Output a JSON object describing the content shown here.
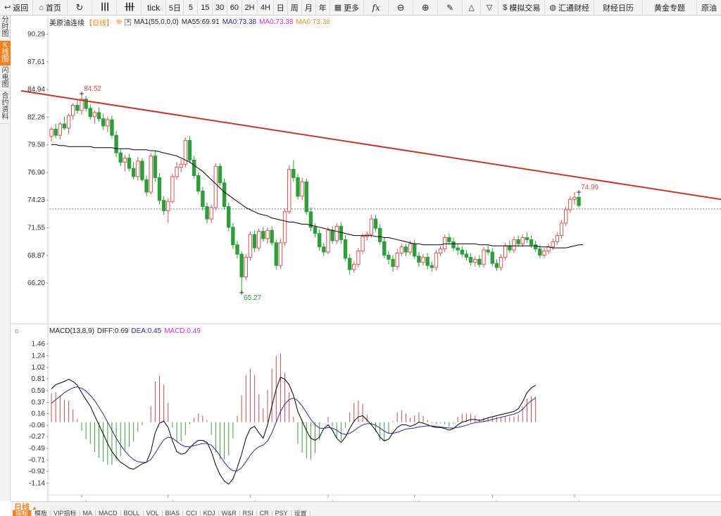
{
  "toolbar": {
    "back": "返回",
    "home": "首页",
    "tick": "tick",
    "periods": [
      "5日",
      "5",
      "15",
      "30",
      "60",
      "2H",
      "4H",
      "日",
      "周",
      "月",
      "年"
    ],
    "more": "更多",
    "fx": "fx",
    "sim_trade": "模拟交易",
    "hui_tong": "汇通财经",
    "calendar": "财经日历",
    "gold": "黄金专题",
    "oil": "原油"
  },
  "left_tabs": [
    {
      "label": "分时图",
      "active": false
    },
    {
      "label": "K线图",
      "active": true
    },
    {
      "label": "闪电图",
      "active": false
    },
    {
      "label": "合约资料",
      "active": false
    }
  ],
  "main_legend": {
    "symbol": "美原油连续",
    "period": "【日线】",
    "ma1": "MA1(55,0,0,0)",
    "ma55": "MA55:69.91",
    "ma0a": "MA0:73.38",
    "ma0b": "MA0:73.38",
    "ma0c": "MA0:73.38"
  },
  "macd_legend": {
    "name": "MACD(13,8,9)",
    "diff": "DIFF:0.69",
    "dea": "DEA:0.45",
    "macd": "MACD:0.49"
  },
  "colors": {
    "up": "#d9534f",
    "down": "#2e9d3a",
    "trendline": "#c0392b",
    "ma": "#000000",
    "dea": "#2a2a9a",
    "macd_label": "#cc33cc",
    "accent": "#f58220",
    "axis_text": "#333333"
  },
  "bottom": {
    "period_label": "日线",
    "indicator_tabs": [
      {
        "label": "指标",
        "active": true
      },
      {
        "label": "模板",
        "active": false
      },
      {
        "label": "VIP指标",
        "active": false
      },
      {
        "label": "MA",
        "active": false
      },
      {
        "label": "MACD",
        "active": false
      },
      {
        "label": "BOLL",
        "active": false
      },
      {
        "label": "VOL",
        "active": false
      },
      {
        "label": "BIAS",
        "active": false
      },
      {
        "label": "CCI",
        "active": false
      },
      {
        "label": "KDJ",
        "active": false
      },
      {
        "label": "W&R",
        "active": false
      },
      {
        "label": "RSI",
        "active": false
      },
      {
        "label": "CR",
        "active": false
      },
      {
        "label": "PSY",
        "active": false
      },
      {
        "label": "设置",
        "active": false
      }
    ]
  },
  "chart_data": [
    {
      "type": "candlestick",
      "title": "美原油连续",
      "y_ticks": [
        "90.29",
        "87.61",
        "84.94",
        "82.26",
        "79.58",
        "76.90",
        "74.23",
        "71.55",
        "68.87",
        "66.20"
      ],
      "ylim": [
        64.3,
        91.0
      ],
      "x_ticks": [
        "2024/07",
        "2024/08",
        "2024/09",
        "2024/10",
        "2024/11",
        "2024/12",
        "2025/01"
      ],
      "annotations": [
        {
          "text": "84.52",
          "value": 84.52,
          "index": 7
        },
        {
          "text": "65.27",
          "value": 65.27,
          "index": 44
        },
        {
          "text": "74.99",
          "value": 74.99,
          "index": 122
        }
      ],
      "current_price": 73.38,
      "trendline": {
        "from": {
          "index": -7,
          "value": 84.8
        },
        "to": {
          "index": 161,
          "value": 73.9
        }
      },
      "candles": [
        [
          80.4,
          81.3,
          79.9,
          81.1
        ],
        [
          81.1,
          81.6,
          80.2,
          80.5
        ],
        [
          80.5,
          81.8,
          80.1,
          81.6
        ],
        [
          81.6,
          82.3,
          81.0,
          81.2
        ],
        [
          81.2,
          82.6,
          80.6,
          82.4
        ],
        [
          82.4,
          83.6,
          82.0,
          83.4
        ],
        [
          83.4,
          83.9,
          82.6,
          82.9
        ],
        [
          82.9,
          84.52,
          82.5,
          84.0
        ],
        [
          84.0,
          84.3,
          82.8,
          83.1
        ],
        [
          83.1,
          83.5,
          82.0,
          82.3
        ],
        [
          82.3,
          82.9,
          81.6,
          82.7
        ],
        [
          82.7,
          83.2,
          81.8,
          82.1
        ],
        [
          82.1,
          82.6,
          81.0,
          81.4
        ],
        [
          81.4,
          82.3,
          80.8,
          82.0
        ],
        [
          82.0,
          82.4,
          80.2,
          80.5
        ],
        [
          80.5,
          80.9,
          78.4,
          78.8
        ],
        [
          78.8,
          79.2,
          77.5,
          77.9
        ],
        [
          77.9,
          78.6,
          77.0,
          78.3
        ],
        [
          78.3,
          78.7,
          77.0,
          77.3
        ],
        [
          77.3,
          77.9,
          76.2,
          76.5
        ],
        [
          76.5,
          78.4,
          76.1,
          78.0
        ],
        [
          78.0,
          78.3,
          76.0,
          76.2
        ],
        [
          76.2,
          76.6,
          74.6,
          75.0
        ],
        [
          75.0,
          78.8,
          74.8,
          78.5
        ],
        [
          78.5,
          79.0,
          76.0,
          76.4
        ],
        [
          76.4,
          76.8,
          73.8,
          74.2
        ],
        [
          74.2,
          74.6,
          72.8,
          73.2
        ],
        [
          73.2,
          74.4,
          72.0,
          74.1
        ],
        [
          74.1,
          76.8,
          73.9,
          76.5
        ],
        [
          76.5,
          77.9,
          76.2,
          77.4
        ],
        [
          77.4,
          78.2,
          76.9,
          77.7
        ],
        [
          77.7,
          80.3,
          77.4,
          80.0
        ],
        [
          80.0,
          80.4,
          77.8,
          78.1
        ],
        [
          78.1,
          78.5,
          76.3,
          76.6
        ],
        [
          76.6,
          76.9,
          74.8,
          75.1
        ],
        [
          75.1,
          75.5,
          73.2,
          73.6
        ],
        [
          73.6,
          74.0,
          72.0,
          72.4
        ],
        [
          72.4,
          73.8,
          72.0,
          73.5
        ],
        [
          73.5,
          77.8,
          73.2,
          77.5
        ],
        [
          77.5,
          77.8,
          75.6,
          75.9
        ],
        [
          75.9,
          76.3,
          73.3,
          73.6
        ],
        [
          73.6,
          74.0,
          71.2,
          71.6
        ],
        [
          71.6,
          72.0,
          69.5,
          69.9
        ],
        [
          69.9,
          70.3,
          68.6,
          69.0
        ],
        [
          69.0,
          69.3,
          65.27,
          66.8
        ],
        [
          66.8,
          69.0,
          66.5,
          68.7
        ],
        [
          68.7,
          71.2,
          68.4,
          70.9
        ],
        [
          70.9,
          71.3,
          69.2,
          69.6
        ],
        [
          69.6,
          71.5,
          69.3,
          71.2
        ],
        [
          71.2,
          71.6,
          70.2,
          70.5
        ],
        [
          70.5,
          71.6,
          70.0,
          71.3
        ],
        [
          71.3,
          71.7,
          69.8,
          70.1
        ],
        [
          70.1,
          70.4,
          67.5,
          67.9
        ],
        [
          67.9,
          70.5,
          67.6,
          70.1
        ],
        [
          70.1,
          73.4,
          69.8,
          73.1
        ],
        [
          73.1,
          77.6,
          72.9,
          77.2
        ],
        [
          77.2,
          78.1,
          76.0,
          76.4
        ],
        [
          76.4,
          76.8,
          74.3,
          74.6
        ],
        [
          74.6,
          76.4,
          74.2,
          76.0
        ],
        [
          76.0,
          76.3,
          72.8,
          73.1
        ],
        [
          73.1,
          73.5,
          71.2,
          71.6
        ],
        [
          71.6,
          72.0,
          70.6,
          71.0
        ],
        [
          71.0,
          71.4,
          69.3,
          69.7
        ],
        [
          69.7,
          70.1,
          68.8,
          69.2
        ],
        [
          69.2,
          71.6,
          69.0,
          71.3
        ],
        [
          71.3,
          71.7,
          70.0,
          70.3
        ],
        [
          70.3,
          72.0,
          70.0,
          71.7
        ],
        [
          71.7,
          72.1,
          70.0,
          70.4
        ],
        [
          70.4,
          70.8,
          68.3,
          68.6
        ],
        [
          68.6,
          69.0,
          67.0,
          67.5
        ],
        [
          67.5,
          68.3,
          67.2,
          68.0
        ],
        [
          68.0,
          69.6,
          67.7,
          69.3
        ],
        [
          69.3,
          71.0,
          69.0,
          70.7
        ],
        [
          70.7,
          71.2,
          70.3,
          70.9
        ],
        [
          70.9,
          72.8,
          70.6,
          72.4
        ],
        [
          72.4,
          72.8,
          71.2,
          71.5
        ],
        [
          71.5,
          71.9,
          69.9,
          70.2
        ],
        [
          70.2,
          70.6,
          68.6,
          68.9
        ],
        [
          68.9,
          69.3,
          68.0,
          68.5
        ],
        [
          68.5,
          68.9,
          67.3,
          67.8
        ],
        [
          67.8,
          69.5,
          67.5,
          69.1
        ],
        [
          69.1,
          70.0,
          68.8,
          69.7
        ],
        [
          69.7,
          70.0,
          68.8,
          69.2
        ],
        [
          69.2,
          70.3,
          68.9,
          70.0
        ],
        [
          70.0,
          70.4,
          68.5,
          68.8
        ],
        [
          68.8,
          69.2,
          67.8,
          68.2
        ],
        [
          68.2,
          69.0,
          67.9,
          68.7
        ],
        [
          68.7,
          69.1,
          67.5,
          67.9
        ],
        [
          67.9,
          68.3,
          67.3,
          67.7
        ],
        [
          67.7,
          69.4,
          67.4,
          69.1
        ],
        [
          69.1,
          69.8,
          68.8,
          69.5
        ],
        [
          69.5,
          70.9,
          69.2,
          70.6
        ],
        [
          70.6,
          71.0,
          69.9,
          70.2
        ],
        [
          70.2,
          70.6,
          69.3,
          69.6
        ],
        [
          69.6,
          70.0,
          68.9,
          69.4
        ],
        [
          69.4,
          69.8,
          68.7,
          69.0
        ],
        [
          69.0,
          69.4,
          68.4,
          68.7
        ],
        [
          68.7,
          69.1,
          67.9,
          68.2
        ],
        [
          68.2,
          68.8,
          67.8,
          68.5
        ],
        [
          68.5,
          68.9,
          67.7,
          68.0
        ],
        [
          68.0,
          69.7,
          67.7,
          69.4
        ],
        [
          69.4,
          69.8,
          68.9,
          69.2
        ],
        [
          69.2,
          69.6,
          67.8,
          68.1
        ],
        [
          68.1,
          68.5,
          67.4,
          67.7
        ],
        [
          67.7,
          69.0,
          67.4,
          68.7
        ],
        [
          68.7,
          70.1,
          68.4,
          69.8
        ],
        [
          69.8,
          70.3,
          69.1,
          69.4
        ],
        [
          69.4,
          70.7,
          69.1,
          70.4
        ],
        [
          70.4,
          70.8,
          69.7,
          70.0
        ],
        [
          70.0,
          70.9,
          69.7,
          70.6
        ],
        [
          70.6,
          71.1,
          70.1,
          70.4
        ],
        [
          70.4,
          70.8,
          69.6,
          69.9
        ],
        [
          69.9,
          70.3,
          69.2,
          69.5
        ],
        [
          69.5,
          69.9,
          68.6,
          68.9
        ],
        [
          68.9,
          69.6,
          68.6,
          69.3
        ],
        [
          69.3,
          70.0,
          69.0,
          69.7
        ],
        [
          69.7,
          70.5,
          69.4,
          70.2
        ],
        [
          70.2,
          71.1,
          69.9,
          70.8
        ],
        [
          70.8,
          72.3,
          70.5,
          72.0
        ],
        [
          72.0,
          73.6,
          71.7,
          73.3
        ],
        [
          73.3,
          74.6,
          73.0,
          74.3
        ],
        [
          74.3,
          74.99,
          73.8,
          74.5
        ],
        [
          74.5,
          74.8,
          73.5,
          73.7
        ]
      ],
      "ma55": [
        79.6,
        79.6,
        79.5,
        79.5,
        79.4,
        79.4,
        79.4,
        79.4,
        79.4,
        79.4,
        79.3,
        79.3,
        79.3,
        79.3,
        79.3,
        79.2,
        79.2,
        79.2,
        79.2,
        79.1,
        79.1,
        79.1,
        79.1,
        79.0,
        79.0,
        78.9,
        78.8,
        78.7,
        78.6,
        78.5,
        78.3,
        78.1,
        77.9,
        77.6,
        77.3,
        77.0,
        76.6,
        76.2,
        75.8,
        75.4,
        75.0,
        74.7,
        74.4,
        74.1,
        73.8,
        73.5,
        73.3,
        73.1,
        72.9,
        72.8,
        72.7,
        72.5,
        72.4,
        72.3,
        72.2,
        72.1,
        72.1,
        72.0,
        71.9,
        71.9,
        71.8,
        71.7,
        71.6,
        71.5,
        71.4,
        71.3,
        71.2,
        71.1,
        71.0,
        70.9,
        70.8,
        70.8,
        70.8,
        70.8,
        70.8,
        70.7,
        70.7,
        70.6,
        70.6,
        70.5,
        70.4,
        70.3,
        70.2,
        70.1,
        70.0,
        70.0,
        69.9,
        69.9,
        69.9,
        69.9,
        69.9,
        70.0,
        70.0,
        70.0,
        70.0,
        70.0,
        70.0,
        70.0,
        70.0,
        69.9,
        69.9,
        69.9,
        69.8,
        69.8,
        69.8,
        69.8,
        69.8,
        69.8,
        69.8,
        69.8,
        69.8,
        69.8,
        69.8,
        69.7,
        69.7,
        69.7,
        69.6,
        69.6,
        69.6,
        69.6,
        69.7,
        69.8,
        69.9,
        69.91
      ]
    },
    {
      "type": "macd",
      "title": "MACD(13,8,9)",
      "y_ticks": [
        "1.46",
        "1.24",
        "1.02",
        "0.81",
        "0.59",
        "0.37",
        "0.16",
        "-0.06",
        "-0.27",
        "-0.49",
        "-0.71",
        "-0.92",
        "-1.14"
      ],
      "ylim": [
        -1.32,
        1.6
      ],
      "diff": [
        0.62,
        0.7,
        0.73,
        0.76,
        0.8,
        0.76,
        0.69,
        0.55,
        0.42,
        0.3,
        0.12,
        -0.05,
        -0.22,
        -0.4,
        -0.55,
        -0.66,
        -0.75,
        -0.8,
        -0.86,
        -0.88,
        -0.83,
        -0.78,
        -0.75,
        -0.55,
        -0.2,
        -0.02,
        0.02,
        -0.1,
        -0.35,
        -0.55,
        -0.6,
        -0.58,
        -0.48,
        -0.4,
        -0.34,
        -0.34,
        -0.38,
        -0.55,
        -0.8,
        -0.98,
        -1.1,
        -1.16,
        -1.06,
        -0.85,
        -0.6,
        -0.3,
        -0.12,
        -0.08,
        -0.2,
        -0.3,
        -0.05,
        0.3,
        0.62,
        0.84,
        0.8,
        0.7,
        0.5,
        0.2,
        0.02,
        -0.16,
        -0.3,
        -0.34,
        -0.28,
        -0.12,
        -0.05,
        -0.15,
        -0.3,
        -0.38,
        -0.28,
        -0.12,
        0.02,
        0.1,
        0.12,
        0.04,
        -0.05,
        -0.15,
        -0.28,
        -0.35,
        -0.32,
        -0.2,
        -0.1,
        -0.05,
        -0.05,
        -0.08,
        -0.05,
        0.0,
        -0.02,
        -0.05,
        -0.08,
        -0.1,
        -0.1,
        -0.12,
        -0.15,
        -0.12,
        -0.05,
        0.0,
        0.02,
        0.05,
        0.05,
        0.03,
        0.05,
        0.08,
        0.1,
        0.12,
        0.14,
        0.16,
        0.18,
        0.2,
        0.25,
        0.38,
        0.55,
        0.64,
        0.69
      ],
      "dea": [
        0.35,
        0.42,
        0.48,
        0.55,
        0.6,
        0.64,
        0.66,
        0.63,
        0.58,
        0.5,
        0.4,
        0.28,
        0.15,
        0.0,
        -0.15,
        -0.3,
        -0.43,
        -0.54,
        -0.63,
        -0.7,
        -0.74,
        -0.75,
        -0.75,
        -0.7,
        -0.58,
        -0.45,
        -0.33,
        -0.28,
        -0.3,
        -0.36,
        -0.42,
        -0.46,
        -0.46,
        -0.44,
        -0.42,
        -0.4,
        -0.4,
        -0.43,
        -0.52,
        -0.63,
        -0.75,
        -0.85,
        -0.91,
        -0.91,
        -0.85,
        -0.74,
        -0.62,
        -0.52,
        -0.46,
        -0.43,
        -0.35,
        -0.2,
        0.0,
        0.2,
        0.34,
        0.42,
        0.45,
        0.4,
        0.3,
        0.18,
        0.05,
        -0.05,
        -0.11,
        -0.12,
        -0.1,
        -0.11,
        -0.15,
        -0.21,
        -0.23,
        -0.21,
        -0.16,
        -0.1,
        -0.05,
        -0.03,
        -0.03,
        -0.06,
        -0.11,
        -0.17,
        -0.21,
        -0.21,
        -0.19,
        -0.16,
        -0.13,
        -0.12,
        -0.11,
        -0.09,
        -0.08,
        -0.07,
        -0.07,
        -0.08,
        -0.09,
        -0.1,
        -0.11,
        -0.11,
        -0.1,
        -0.08,
        -0.06,
        -0.03,
        -0.01,
        0.0,
        0.01,
        0.03,
        0.05,
        0.07,
        0.09,
        0.11,
        0.13,
        0.15,
        0.18,
        0.24,
        0.33,
        0.4,
        0.45
      ]
    }
  ]
}
